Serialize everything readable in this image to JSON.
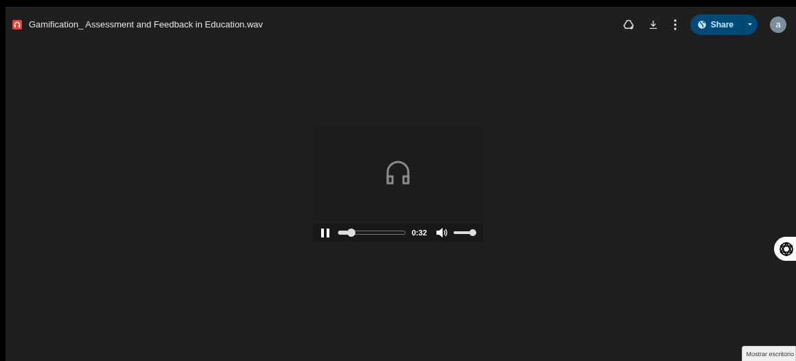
{
  "header": {
    "title": "Gamification_ Assessment and Feedback in Education.wav",
    "share_label": "Share",
    "avatar_letter": "a"
  },
  "player": {
    "playing": true,
    "progress": {
      "level": 0.15
    },
    "time": "0:32",
    "volume": {
      "level": 1
    }
  },
  "tooltip": "Mostrar escritorio"
}
